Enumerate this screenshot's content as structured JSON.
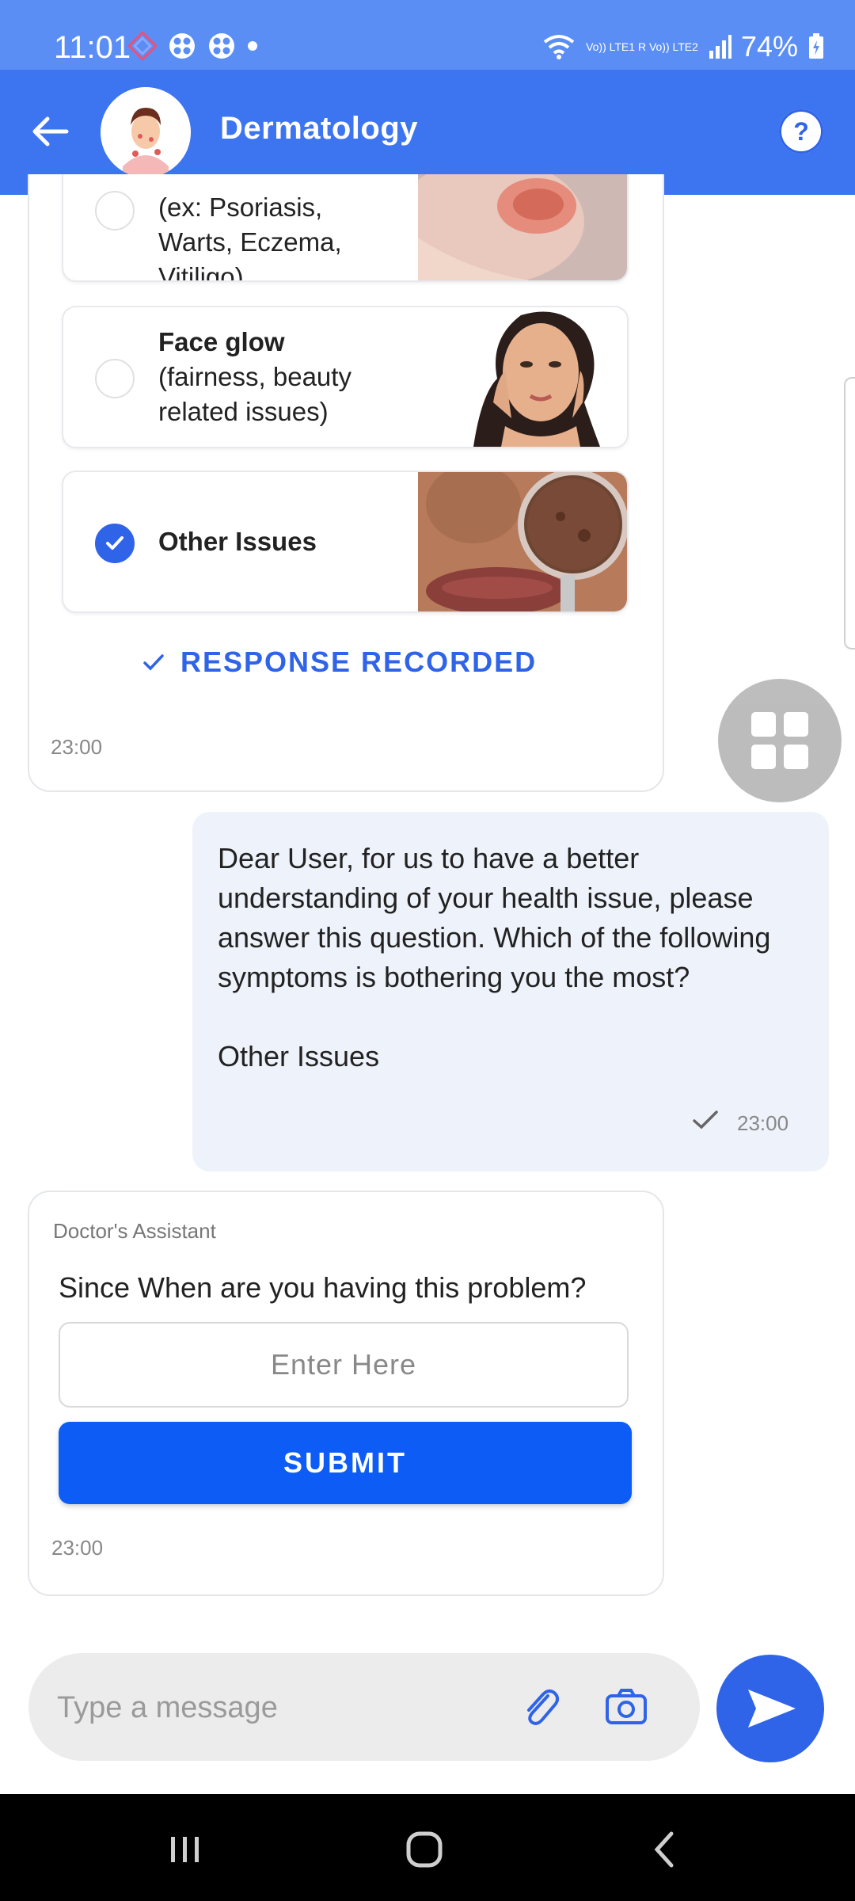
{
  "status_bar": {
    "time": "11:01",
    "network_label": "Vo)) LTE1 R Vo)) LTE2",
    "battery": "74%"
  },
  "header": {
    "title": "Dermatology",
    "help": "?"
  },
  "options_card": {
    "options": [
      {
        "title": "",
        "subtitle": "(ex: Psoriasis, Warts, Eczema, Vitiligo)",
        "checked": false
      },
      {
        "title": "Face glow",
        "subtitle": "(fairness, beauty related issues)",
        "checked": false
      },
      {
        "title": "Other Issues",
        "subtitle": "",
        "checked": true
      }
    ],
    "recorded_label": "RESPONSE RECORDED",
    "time": "23:00"
  },
  "user_message": {
    "text": "Dear User, for us to have a better understanding of your health issue, please answer this question. Which of the following symptoms is bothering you the most?",
    "answer": "Other Issues",
    "time": "23:00"
  },
  "assistant_card": {
    "sender": "Doctor's Assistant",
    "question": "Since When are you having this problem?",
    "input_placeholder": "Enter Here",
    "submit_label": "SUBMIT",
    "time": "23:00"
  },
  "composer": {
    "placeholder": "Type a message"
  },
  "colors": {
    "header": "#3d74f0",
    "status_bar": "#5b8ef5",
    "accent": "#2f64e8",
    "submit": "#0d5cf5"
  },
  "icons": [
    "back-arrow-icon",
    "help-icon",
    "attach-icon",
    "camera-icon",
    "send-icon",
    "grid-icon",
    "check-icon"
  ]
}
